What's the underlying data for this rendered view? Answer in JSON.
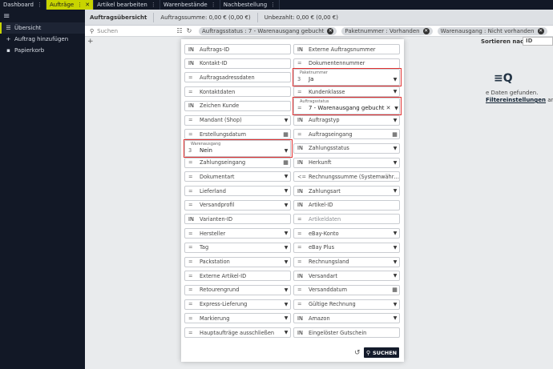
{
  "topbar": {
    "tabs": [
      {
        "label": "Dashboard",
        "active": false,
        "close": false
      },
      {
        "label": "Aufträge",
        "active": true,
        "close": true
      },
      {
        "label": "Artikel bearbeiten",
        "active": false,
        "close": false
      },
      {
        "label": "Warenbestände",
        "active": false,
        "close": false
      },
      {
        "label": "Nachbestellung",
        "active": false,
        "close": false
      }
    ],
    "dots": "⋮",
    "close": "✕"
  },
  "sidebar": {
    "menu_icon": "≡",
    "items": [
      {
        "label": "Übersicht",
        "icon": "list-search-icon",
        "glyph": "☰",
        "active": true
      },
      {
        "label": "Auftrag hinzufügen",
        "icon": "plus-icon",
        "glyph": "+",
        "active": false
      },
      {
        "label": "Papierkorb",
        "icon": "trash-icon",
        "glyph": "▪",
        "active": false
      }
    ]
  },
  "header": {
    "title": "Auftragsübersicht",
    "sum": "Auftragssumme: 0,00 € (0,00 €)",
    "unpaid": "Unbezahlt: 0,00 € (0,00 €)"
  },
  "filterbar": {
    "search_placeholder": "Suchen",
    "chips": [
      "Auftragsstatus : 7 - Warenausgang gebucht",
      "Paketnummer : Vorhanden",
      "Warenausgang : Nicht vorhanden"
    ]
  },
  "sort": {
    "label": "Sortieren nach:",
    "value": "ID"
  },
  "empty": {
    "line1": "e Daten gefunden.",
    "link": "Filtereinstellungen",
    "line2_suffix": " an."
  },
  "modal": {
    "left": [
      {
        "op": "IN",
        "label": "Auftrags-ID",
        "type": "text"
      },
      {
        "op": "IN",
        "label": "Kontakt-ID",
        "type": "text"
      },
      {
        "op": "=",
        "label": "Auftragsadressdaten",
        "type": "text"
      },
      {
        "op": "=",
        "label": "Kontaktdaten",
        "type": "text"
      },
      {
        "op": "IN",
        "label": "Zeichen Kunde",
        "type": "text"
      },
      {
        "op": "=",
        "label": "Mandant (Shop)",
        "type": "select"
      },
      {
        "op": "=",
        "label": "Erstellungsdatum",
        "type": "date"
      },
      {
        "op": "3",
        "label": "Warenausgang",
        "type": "filled",
        "value": "Nein"
      },
      {
        "op": "=",
        "label": "Zahlungseingang",
        "type": "date"
      },
      {
        "op": "=",
        "label": "Dokumentart",
        "type": "select"
      },
      {
        "op": "=",
        "label": "Lieferland",
        "type": "select"
      },
      {
        "op": "=",
        "label": "Versandprofil",
        "type": "select"
      },
      {
        "op": "IN",
        "label": "Varianten-ID",
        "type": "text"
      },
      {
        "op": "=",
        "label": "Hersteller",
        "type": "select"
      },
      {
        "op": "=",
        "label": "Tag",
        "type": "select"
      },
      {
        "op": "=",
        "label": "Packstation",
        "type": "select"
      },
      {
        "op": "=",
        "label": "Externe Artikel-ID",
        "type": "text"
      },
      {
        "op": "=",
        "label": "Retourengrund",
        "type": "select"
      },
      {
        "op": "=",
        "label": "Express-Lieferung",
        "type": "select"
      },
      {
        "op": "=",
        "label": "Markierung",
        "type": "select"
      },
      {
        "op": "=",
        "label": "Hauptaufträge ausschließen",
        "type": "select"
      }
    ],
    "right": [
      {
        "op": "IN",
        "label": "Externe Auftragsnummer",
        "type": "text"
      },
      {
        "op": "=",
        "label": "Dokumentennummer",
        "type": "text"
      },
      {
        "op": "3",
        "label": "Paketnummer",
        "type": "filled",
        "value": "Ja"
      },
      {
        "op": "=",
        "label": "Kundenklasse",
        "type": "select"
      },
      {
        "op": "=",
        "label": "Auftragsstatus",
        "type": "filled-clear",
        "value": "7 - Warenausgang gebucht"
      },
      {
        "op": "IN",
        "label": "Auftragstyp",
        "type": "select"
      },
      {
        "op": "=",
        "label": "Auftragseingang",
        "type": "date"
      },
      {
        "op": "IN",
        "label": "Zahlungsstatus",
        "type": "select"
      },
      {
        "op": "IN",
        "label": "Herkunft",
        "type": "select"
      },
      {
        "op": "<=",
        "label": "Rechnungssumme (Systemwährung)",
        "type": "text"
      },
      {
        "op": "IN",
        "label": "Zahlungsart",
        "type": "select"
      },
      {
        "op": "IN",
        "label": "Artikel-ID",
        "type": "text"
      },
      {
        "op": "=",
        "label": "Artikeldaten",
        "type": "text-dim"
      },
      {
        "op": "=",
        "label": "eBay-Konto",
        "type": "select"
      },
      {
        "op": "=",
        "label": "eBay Plus",
        "type": "select"
      },
      {
        "op": "=",
        "label": "Rechnungsland",
        "type": "select"
      },
      {
        "op": "IN",
        "label": "Versandart",
        "type": "select"
      },
      {
        "op": "=",
        "label": "Versanddatum",
        "type": "date"
      },
      {
        "op": "=",
        "label": "Gültige Rechnung",
        "type": "select"
      },
      {
        "op": "IN",
        "label": "Amazon",
        "type": "select"
      },
      {
        "op": "IN",
        "label": "Eingelöster Gutschein",
        "type": "text"
      }
    ],
    "search_button": "SUCHEN",
    "highlight_color": "#e03030"
  }
}
